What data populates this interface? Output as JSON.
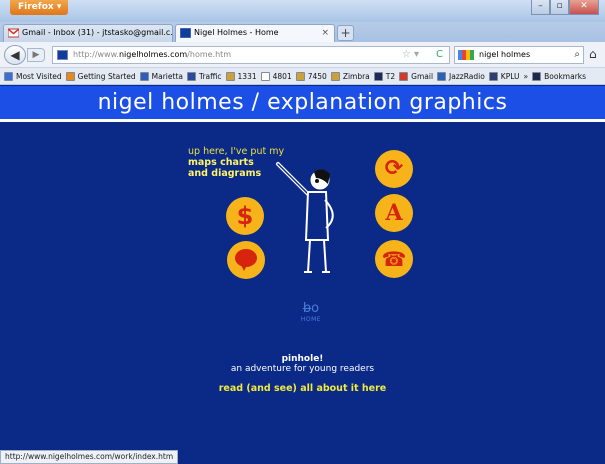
{
  "browser": {
    "app_button": "Firefox",
    "tabs": [
      {
        "label": "Gmail - Inbox (31) - jtstasko@gmail.c...",
        "active": false
      },
      {
        "label": "Nigel Holmes - Home",
        "active": true
      }
    ],
    "url": {
      "prefix": "http://www.",
      "host": "nigelholmes.com",
      "path": "/home.htm"
    },
    "search_text": "nigel holmes",
    "bookmarks": [
      {
        "label": "Most Visited",
        "color": "#3b6fd1"
      },
      {
        "label": "Getting Started",
        "color": "#e48a1c"
      },
      {
        "label": "Marietta",
        "color": "#2d5fb8"
      },
      {
        "label": "Traffic",
        "color": "#2a4a9a"
      },
      {
        "label": "1331",
        "color": "#c9a23a"
      },
      {
        "label": "4801",
        "color": "#ffffff"
      },
      {
        "label": "7450",
        "color": "#c9a23a"
      },
      {
        "label": "Zimbra",
        "color": "#c9a23a"
      },
      {
        "label": "T2",
        "color": "#1d2b5a"
      },
      {
        "label": "Gmail",
        "color": "#d43a2a"
      },
      {
        "label": "JazzRadio",
        "color": "#2a62b8"
      },
      {
        "label": "KPLU",
        "color": "#2b3f73"
      },
      {
        "label": "Bookmarks",
        "color": "#1b2a4a"
      }
    ],
    "bookmarks_overflow": "»",
    "status_url": "http://www.nigelholmes.com/work/index.htm"
  },
  "page": {
    "site_title": "nigel holmes / explanation graphics",
    "intro_line1": "up here, I've put my",
    "intro_line2": "maps charts",
    "intro_line3": "and diagrams",
    "icons": {
      "dollar": "$",
      "refresh": "⟳",
      "font": "A",
      "phone": "☎"
    },
    "home_label": "HOME",
    "pinhole_title": "pinhole!",
    "pinhole_subtitle": "an adventure for young readers",
    "pinhole_link": "read (and see) all about it here"
  },
  "colors": {
    "page_bg": "#0b2a88",
    "header_band": "#1b4fe6",
    "icon_circle": "#f6b41a",
    "icon_glyph": "#d6240e",
    "accent_yellow": "#f0ea3c"
  }
}
